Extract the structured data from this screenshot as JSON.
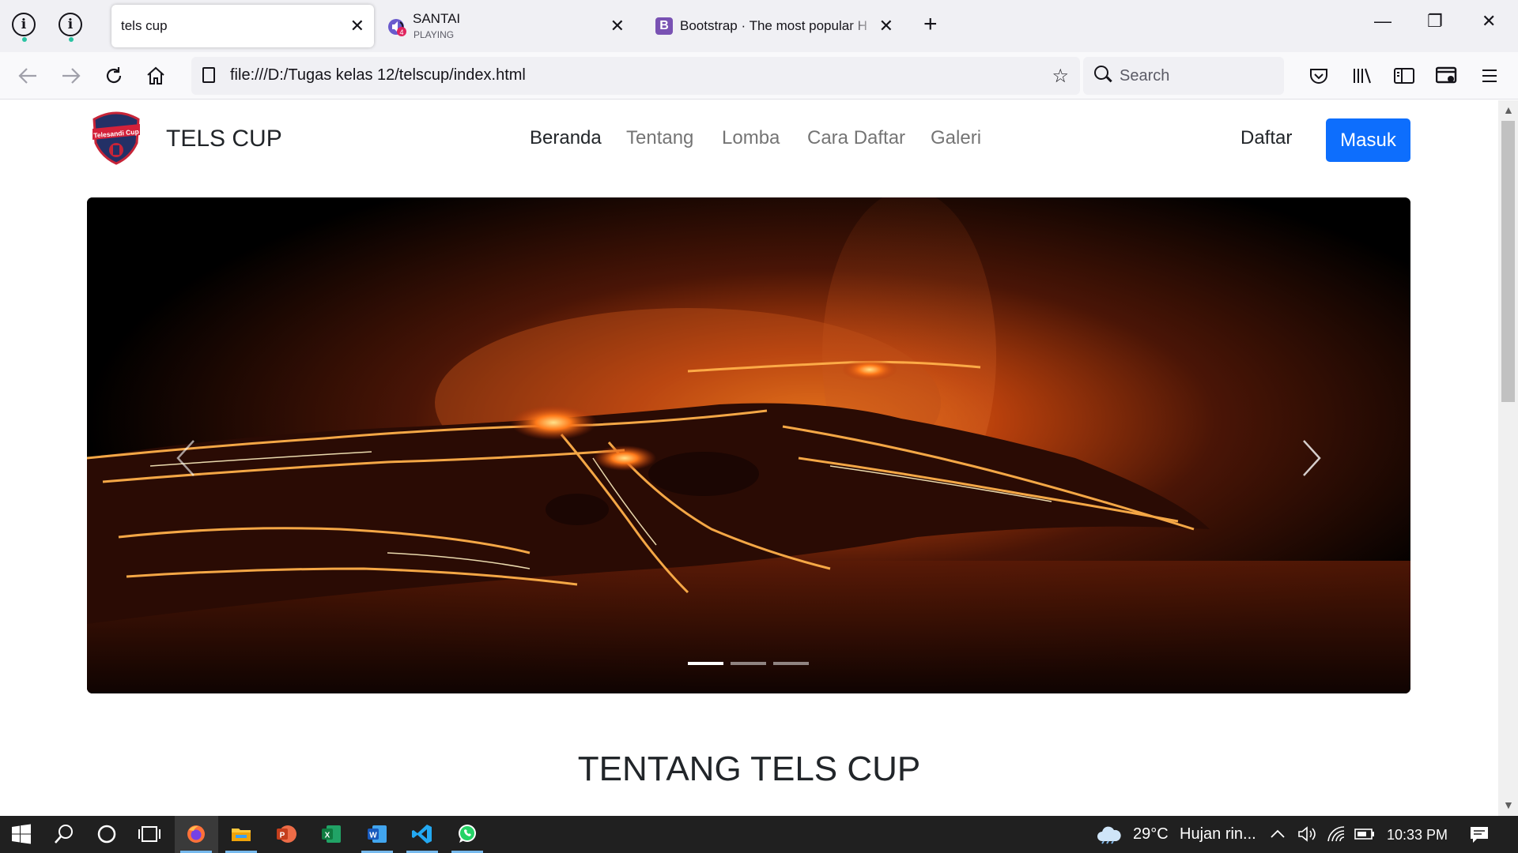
{
  "browser": {
    "tabs": [
      {
        "title": "tels cup",
        "active": true
      },
      {
        "title": "SANTAI",
        "subtitle": "PLAYING",
        "audio_badge": "4"
      },
      {
        "title": "Bootstrap · The most popular H",
        "favicon_letter": "B"
      }
    ],
    "new_tab_symbol": "+",
    "close_symbol": "✕",
    "window_controls": {
      "minimize": "—",
      "restore": "❐",
      "close": "✕"
    },
    "url": "file:///D:/Tugas kelas 12/telscup/index.html",
    "search_placeholder": "Search",
    "icons": [
      "back-icon",
      "forward-icon",
      "reload-icon",
      "home-icon",
      "bookmark-star-icon",
      "pocket-icon",
      "library-icon",
      "sidebar-icon",
      "screenshot-icon",
      "menu-icon"
    ]
  },
  "site": {
    "brand": "TELS CUP",
    "logo_text": "Telesandi Cup",
    "nav": [
      "Beranda",
      "Tentang",
      "Lomba",
      "Cara Daftar",
      "Galeri"
    ],
    "active_nav": "Beranda",
    "daftar": "Daftar",
    "masuk": "Masuk",
    "carousel": {
      "slides": 3,
      "active_slide": 1
    },
    "section_title": "TENTANG TELS CUP"
  },
  "colors": {
    "primary": "#0d6efd",
    "tab_strip": "#f0f0f4",
    "taskbar": "#202020"
  },
  "taskbar": {
    "apps": [
      "start-icon",
      "search-icon",
      "cortana-icon",
      "task-view-icon",
      "firefox-icon",
      "file-explorer-icon",
      "powerpoint-icon",
      "excel-icon",
      "word-icon",
      "vscode-icon",
      "whatsapp-icon"
    ],
    "weather_temp": "29°C",
    "weather_text": "Hujan rin...",
    "time": "10:33 PM"
  }
}
